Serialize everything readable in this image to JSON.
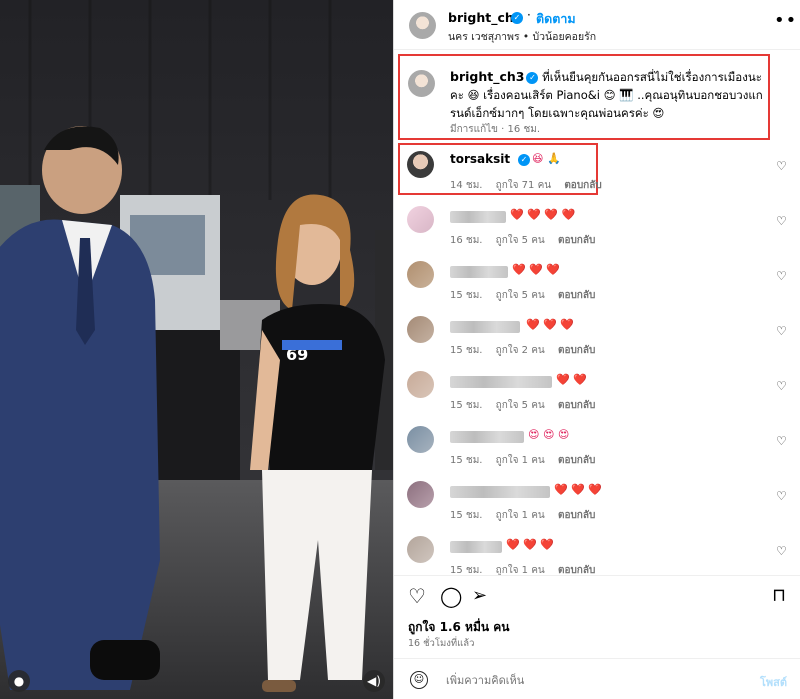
{
  "header": {
    "username": "bright_ch3",
    "follow_label": "ติดตาม",
    "subtitle": "นคร เวชสุภาพร • บัวน้อยคอยรัก",
    "more_icon": "more-icon"
  },
  "caption": {
    "username": "bright_ch3",
    "text": "ที่เห็นยืนคุยกันออกรสนี่ไม่ใช่เรื่องการเมืองนะคะ 😆 เรื่องคอนเสิร์ต Piano&i 😊 🎹 ..คุณอนุทินบอกชอบวงแกรนด์เอ็กซ์มากๆ โดยเฉพาะคุณพ่อนครค่ะ 😍",
    "meta": "มีการแก้ไข · 16 ชม."
  },
  "comments": [
    {
      "username": "torsaksit",
      "verified": true,
      "text": "😆 🙏",
      "time": "14 ชม.",
      "likes": "ถูกใจ 71 คน",
      "reply": "ตอบกลับ",
      "blurred": false
    },
    {
      "username": "",
      "text": "❤️ ❤️ ❤️ ❤️",
      "time": "16 ชม.",
      "likes": "ถูกใจ 5 คน",
      "reply": "ตอบกลับ",
      "blurred": true
    },
    {
      "username": "",
      "text": "❤️ ❤️ ❤️",
      "time": "15 ชม.",
      "likes": "ถูกใจ 5 คน",
      "reply": "ตอบกลับ",
      "blurred": true
    },
    {
      "username": "",
      "text": "❤️ ❤️ ❤️",
      "time": "15 ชม.",
      "likes": "ถูกใจ 2 คน",
      "reply": "ตอบกลับ",
      "blurred": true
    },
    {
      "username": "",
      "text": "❤️ ❤️",
      "time": "15 ชม.",
      "likes": "ถูกใจ 5 คน",
      "reply": "ตอบกลับ",
      "blurred": true
    },
    {
      "username": "",
      "text": "😍 😍 😍",
      "time": "15 ชม.",
      "likes": "ถูกใจ 1 คน",
      "reply": "ตอบกลับ",
      "blurred": true
    },
    {
      "username": "",
      "text": "❤️ ❤️ ❤️",
      "time": "15 ชม.",
      "likes": "ถูกใจ 1 คน",
      "reply": "ตอบกลับ",
      "blurred": true
    },
    {
      "username": "",
      "text": "❤️ ❤️ ❤️",
      "time": "15 ชม.",
      "likes": "ถูกใจ 1 คน",
      "reply": "ตอบกลับ",
      "blurred": true
    }
  ],
  "footer": {
    "likes": "ถูกใจ 1.6 หมื่น คน",
    "time": "16 ชั่วโมงที่แล้ว",
    "comment_placeholder": "เพิ่มความคิดเห็น",
    "post_label": "โพสต์"
  },
  "media": {
    "shirt_text": "69"
  },
  "colors": {
    "accent": "#0095f6",
    "highlight_box": "#e53935",
    "heart": "#e0245e"
  }
}
